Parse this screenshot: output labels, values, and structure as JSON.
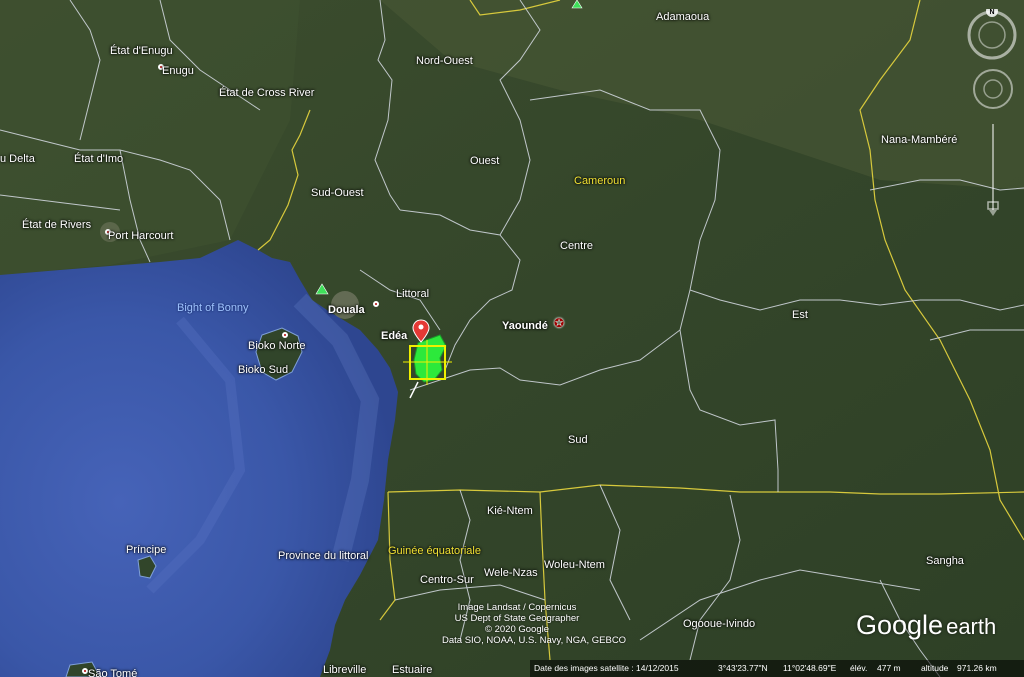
{
  "map": {
    "labels": {
      "adamaoua": "Adamaoua",
      "etat_enugu": "État d'Enugu",
      "enugu": "Enugu",
      "nord_ouest": "Nord-Ouest",
      "etat_cross_river": "État de Cross River",
      "delta": "u Delta",
      "etat_imo": "État d'Imo",
      "ouest": "Ouest",
      "nana_mambere": "Nana-Mambéré",
      "cameroun": "Cameroun",
      "sud_ouest": "Sud-Ouest",
      "etat_rivers": "État de Rivers",
      "port_harcourt": "Port Harcourt",
      "centre": "Centre",
      "littoral": "Littoral",
      "bight_of_bonny": "Bight of Bonny",
      "douala": "Douala",
      "est": "Est",
      "edea": "Edéa",
      "yaounde": "Yaoundé",
      "bioko_norte": "Bioko Norte",
      "bioko_sud": "Bioko Sud",
      "sud": "Sud",
      "kie_ntem": "Kié-Ntem",
      "principe": "Príncipe",
      "guinee_equatoriale": "Guinée équatoriale",
      "province_littoral": "Province du littoral",
      "woleu_ntem": "Woleu-Ntem",
      "sangha": "Sangha",
      "wele_nzas": "Wele-Nzas",
      "centro_sur": "Centro-Sur",
      "ogooue_ivindo": "Ogooue-Ivindo",
      "libreville": "Libreville",
      "estuaire": "Estuaire",
      "sao_tome": "São Tomé"
    },
    "credits": [
      "Image Landsat / Copernicus",
      "US Dept of State Geographer",
      "© 2020 Google",
      "Data SIO, NOAA, U.S. Navy, NGA, GEBCO"
    ],
    "status": {
      "imagery_date": "Date des images satellite : 14/12/2015",
      "lat": "3°43'23.77\"N",
      "lon": "11°02'48.69\"E",
      "elev_label": "élév.",
      "elev": "477 m",
      "alt_label": "altitude",
      "alt": "971.26 km"
    },
    "logo": {
      "google": "Google",
      "earth": "earth"
    },
    "nav": {
      "north": "N"
    },
    "colors": {
      "ocean": "#3a57a8",
      "land": "#36462a",
      "border_admin": "#d8dde6",
      "border_country": "#d7c93c",
      "overlay_polygon": "#2cf23c",
      "overlay_box": "#f0f000",
      "placemark": "#e53935"
    }
  }
}
